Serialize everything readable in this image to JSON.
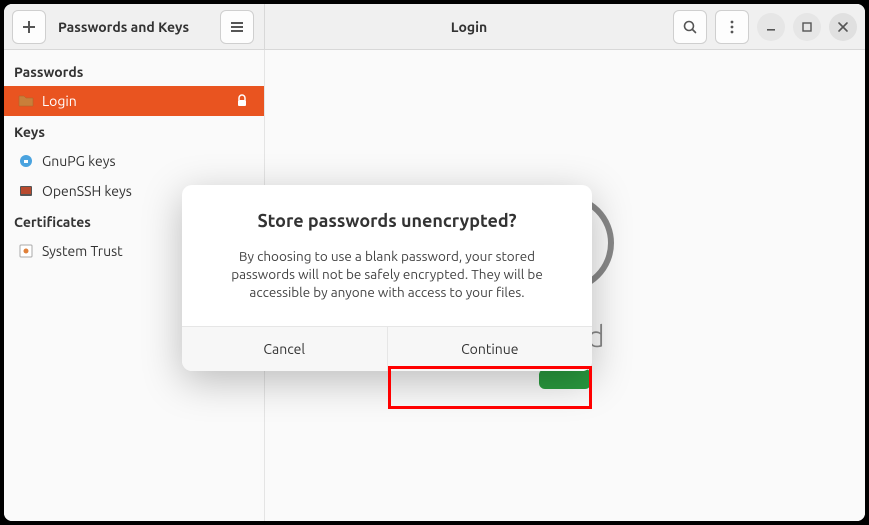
{
  "titlebar": {
    "app_title": "Passwords and Keys",
    "page_title": "Login"
  },
  "sidebar": {
    "sections": {
      "passwords": {
        "header": "Passwords",
        "items": [
          {
            "label": "Login",
            "icon": "folder",
            "selected": true,
            "locked": true
          }
        ]
      },
      "keys": {
        "header": "Keys",
        "items": [
          {
            "label": "GnuPG keys",
            "icon": "gnupg"
          },
          {
            "label": "OpenSSH keys",
            "icon": "openssh"
          }
        ]
      },
      "certs": {
        "header": "Certificates",
        "items": [
          {
            "label": "System Trust",
            "icon": "cert"
          }
        ]
      }
    }
  },
  "main": {
    "locked_text": "ocked",
    "unlock_label": ""
  },
  "dialog": {
    "title": "Store passwords unencrypted?",
    "message": "By choosing to use a blank password, your stored passwords will not be safely encrypted. They will be accessible by anyone with access to your files.",
    "cancel": "Cancel",
    "continue": "Continue"
  }
}
